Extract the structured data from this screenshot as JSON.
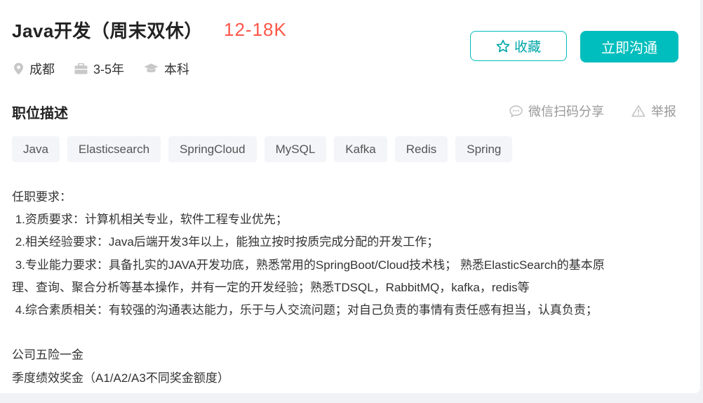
{
  "job": {
    "title": "Java开发（周末双休）",
    "salary": "12-18K",
    "city": "成都",
    "experience": "3-5年",
    "degree": "本科"
  },
  "actions": {
    "favorite_label": "收藏",
    "chat_label": "立即沟通"
  },
  "description": {
    "section_title": "职位描述",
    "share_label": "微信扫码分享",
    "report_label": "举报",
    "tags": [
      "Java",
      "Elasticsearch",
      "SpringCloud",
      "MySQL",
      "Kafka",
      "Redis",
      "Spring"
    ],
    "lines": [
      "任职要求：",
      " 1.资质要求：计算机相关专业，软件工程专业优先；",
      " 2.相关经验要求：Java后端开发3年以上，能独立按时按质完成分配的开发工作；",
      " 3.专业能力要求：具备扎实的JAVA开发功底，熟悉常用的SpringBoot/Cloud技术栈； 熟悉ElasticSearch的基本原",
      "理、查询、聚合分析等基本操作，并有一定的开发经验；熟悉TDSQL，RabbitMQ，kafka，redis等",
      " 4.综合素质相关：有较强的沟通表达能力，乐于与人交流问题；对自己负责的事情有责任感有担当，认真负责；",
      "",
      "公司五险一金",
      "季度绩效奖金（A1/A2/A3不同奖金额度）"
    ]
  },
  "colors": {
    "accent": "#00bebd",
    "salary": "#fe574a",
    "muted": "#999999"
  }
}
